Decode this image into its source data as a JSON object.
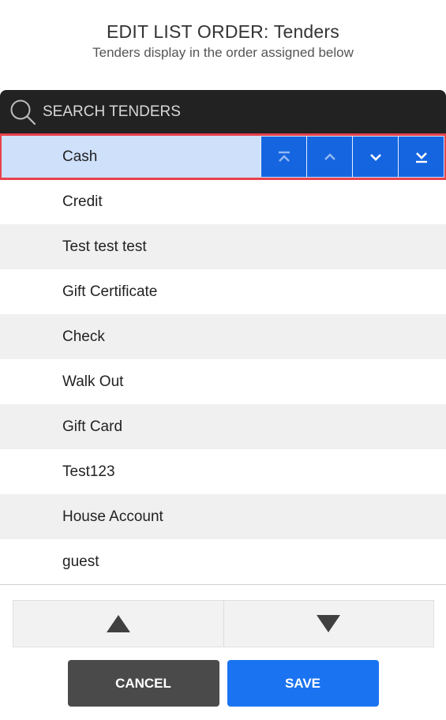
{
  "header": {
    "title": "EDIT LIST ORDER: Tenders",
    "subtitle": "Tenders display in the order assigned below"
  },
  "search": {
    "placeholder": "SEARCH TENDERS",
    "icon": "search-icon"
  },
  "tenders": [
    {
      "label": "Cash",
      "selected": true
    },
    {
      "label": "Credit"
    },
    {
      "label": "Test test test"
    },
    {
      "label": "Gift Certificate"
    },
    {
      "label": "Check"
    },
    {
      "label": "Walk Out"
    },
    {
      "label": "Gift Card"
    },
    {
      "label": "Test123"
    },
    {
      "label": "House Account"
    },
    {
      "label": "guest"
    }
  ],
  "row_actions": [
    "move-to-top-icon",
    "move-up-icon",
    "move-down-icon",
    "move-to-bottom-icon"
  ],
  "arrows": [
    "arrow-up-icon",
    "arrow-down-icon"
  ],
  "footer": {
    "cancel_label": "CANCEL",
    "save_label": "SAVE"
  },
  "colors": {
    "accent": "#1565e0",
    "selected_row": "#cfe0fb",
    "selection_border": "#e8424c",
    "search_bg": "#222222",
    "cancel_bg": "#4a4a4a",
    "save_bg": "#1a73f0"
  }
}
